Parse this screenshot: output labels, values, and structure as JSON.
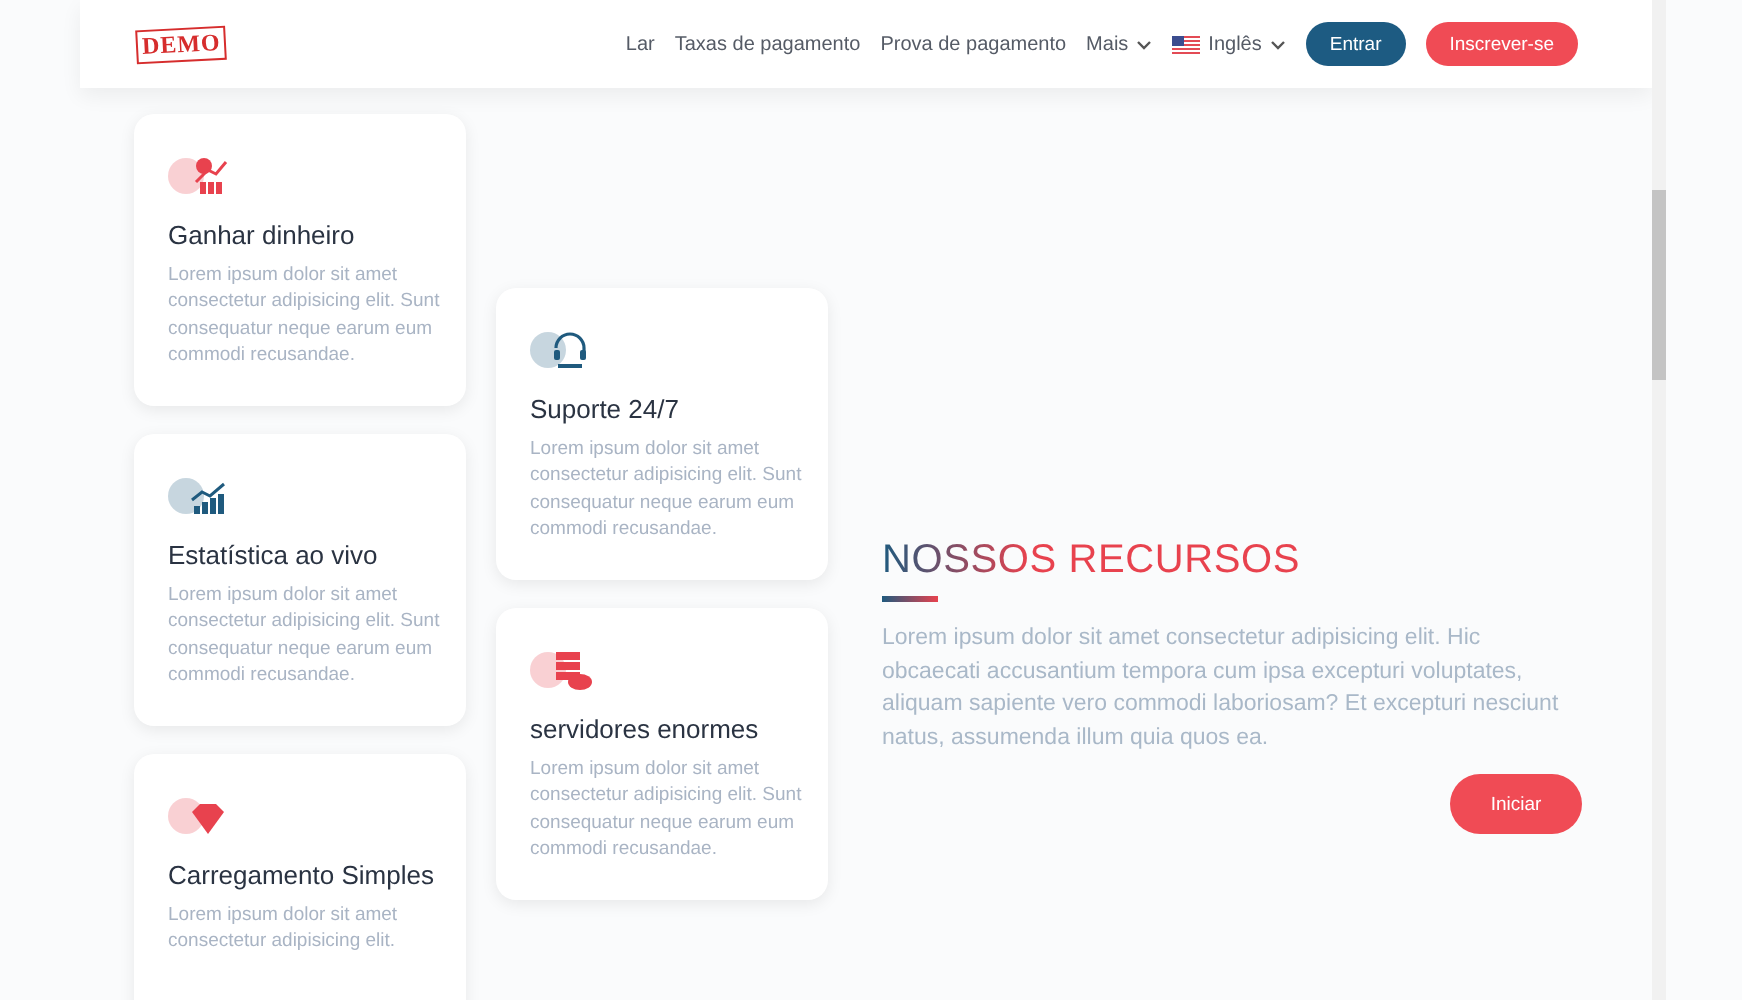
{
  "header": {
    "logo": "DEMO",
    "nav": [
      {
        "label": "Lar",
        "kind": "link"
      },
      {
        "label": "Taxas de pagamento",
        "kind": "link"
      },
      {
        "label": "Prova de pagamento",
        "kind": "link"
      },
      {
        "label": "Mais",
        "kind": "dropdown"
      },
      {
        "label": "Inglês",
        "kind": "language"
      }
    ],
    "buttons": [
      {
        "label": "Entrar",
        "kind": "primary"
      },
      {
        "label": "Inscrever-se",
        "kind": "accent"
      }
    ]
  },
  "columns": [
    [
      {
        "title": "Ganhar dinheiro",
        "description": "Lorem ipsum dolor sit amet consectetur adipisicing elit. Sunt consequatur neque earum eum commodi recusandae.",
        "kind": "money",
        "color": "#e8424e"
      },
      {
        "title": "Estatística ao vivo",
        "description": "Lorem ipsum dolor sit amet consectetur adipisicing elit. Sunt consequatur neque earum eum commodi recusandae.",
        "kind": "chart",
        "color": "#1f5a7e"
      },
      {
        "title": "Carregamento Simples",
        "description": "Lorem ipsum dolor sit amet consectetur adipisicing elit.",
        "kind": "diamond",
        "color": "#e8424e"
      }
    ],
    [
      {
        "title": "Suporte 24/7",
        "description": "Lorem ipsum dolor sit amet consectetur adipisicing elit. Sunt consequatur neque earum eum commodi recusandae.",
        "kind": "support",
        "color": "#1f5a7e"
      },
      {
        "title": "servidores enormes",
        "description": "Lorem ipsum dolor sit amet consectetur adipisicing elit. Sunt consequatur neque earum eum commodi recusandae.",
        "kind": "servers",
        "color": "#e8424e"
      }
    ]
  ],
  "features": {
    "heading": "NOSSOS RECURSOS",
    "text": "Lorem ipsum dolor sit amet consectetur adipisicing elit. Hic obcaecati accusantium tempora cum ipsa excepturi voluptates, aliquam sapiente vero commodi laboriosam? Et excepturi nesciunt natus, assumenda illum quia quos ea.",
    "button": "Iniciar"
  }
}
